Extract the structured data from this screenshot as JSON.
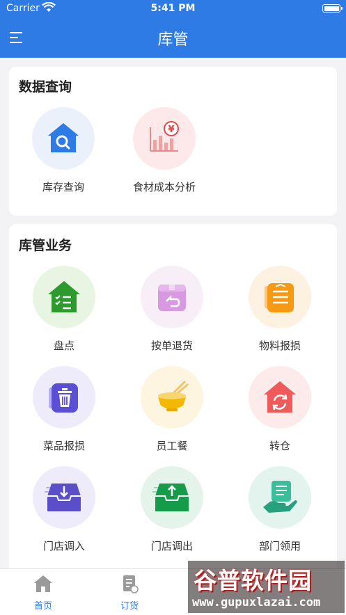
{
  "status_bar": {
    "carrier": "Carrier",
    "time": "5:41 PM"
  },
  "header": {
    "title": "库管",
    "menu_icon": "menu-icon",
    "color": "#2f7be6"
  },
  "data_query": {
    "title": "数据查询",
    "items": [
      {
        "label": "库存查询",
        "icon": "inventory-search-icon",
        "bg": "#eaf1fb"
      },
      {
        "label": "食材成本分析",
        "icon": "cost-chart-icon",
        "bg": "#fde9ea"
      }
    ]
  },
  "warehouse_business": {
    "title": "库管业务",
    "items": [
      {
        "label": "盘点",
        "icon": "stocktake-house-icon",
        "bg": "#e9f5e3"
      },
      {
        "label": "按单退货",
        "icon": "return-box-icon",
        "bg": "#f8eef8"
      },
      {
        "label": "物料报损",
        "icon": "material-loss-icon",
        "bg": "#fdf1e2"
      },
      {
        "label": "菜品报损",
        "icon": "trash-icon",
        "bg": "#eeecfb"
      },
      {
        "label": "员工餐",
        "icon": "noodle-bowl-icon",
        "bg": "#fdf5e0"
      },
      {
        "label": "转仓",
        "icon": "transfer-house-icon",
        "bg": "#fdeaea"
      },
      {
        "label": "门店调入",
        "icon": "inbox-in-icon",
        "bg": "#eeecfb"
      },
      {
        "label": "门店调出",
        "icon": "inbox-out-icon",
        "bg": "#e4f4ea"
      },
      {
        "label": "部门领用",
        "icon": "hand-document-icon",
        "bg": "#e3f4ef"
      }
    ]
  },
  "tabbar": {
    "tabs": [
      {
        "label": "首页",
        "icon": "home-icon"
      },
      {
        "label": "订货",
        "icon": "order-icon"
      }
    ]
  },
  "watermark": {
    "title": "谷普软件园",
    "url": "www.gupuxlazai.com"
  }
}
